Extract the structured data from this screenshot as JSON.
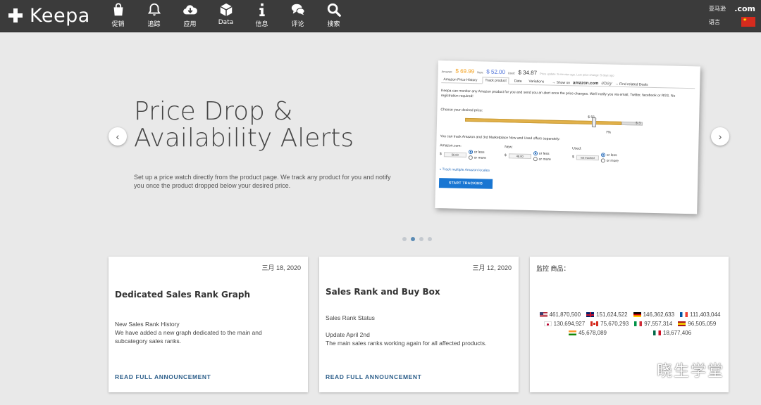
{
  "navbar": {
    "logo_text": "Keepa",
    "items": [
      {
        "label": "促销",
        "icon": "shopping-bag-icon"
      },
      {
        "label": "追踪",
        "icon": "bell-icon"
      },
      {
        "label": "应用",
        "icon": "cloud-download-icon"
      },
      {
        "label": "Data",
        "icon": "cube-icon"
      },
      {
        "label": "信息",
        "icon": "info-icon"
      },
      {
        "label": "评论",
        "icon": "comments-icon"
      },
      {
        "label": "搜索",
        "icon": "search-icon"
      }
    ],
    "right": {
      "marketplace_label": "亚马逊",
      "domain": ".com",
      "language_label": "语言"
    }
  },
  "hero": {
    "title": "Price Drop & Availability Alerts",
    "description": "Set up a price watch directly from the product page. We track any product for you and notify you once the product dropped below your desired price.",
    "screenshot": {
      "amazon_label": "Amazon:",
      "amazon_price": "$ 69.99",
      "new_label": "New:",
      "new_price": "$ 52.00",
      "used_label": "Used:",
      "used_price": "$ 34.87",
      "update_note": "Price update: 5 minutes ago. Last price change: 5 days ago",
      "tabs": [
        "Amazon Price History",
        "Track product",
        "Data",
        "Variations"
      ],
      "show_on": "→ Show on",
      "amazon_logo": "amazon.com",
      "ebay_logo": "ebay",
      "find_deals": "→ Find related Deals",
      "intro": "Keepa can monitor any Amazon product for you and send you an alert once the price changes. We'll notify you via email, Twitter, facebook or RSS. No registration required!",
      "choose_label": "Choose your desired price:",
      "slider_price": "$ 56",
      "slider_pct": "7%",
      "slider_min": "$ 3",
      "track_desc": "You can track Amazon and 3rd Marketplace New and Used offers separately:",
      "columns": [
        {
          "label": "Amazon.com:",
          "value": "56.00",
          "opt1": "or less",
          "opt2": "or more"
        },
        {
          "label": "New:",
          "value": "48.00",
          "opt1": "or less",
          "opt2": "or more"
        },
        {
          "label": "Used:",
          "value": "not tracked",
          "opt1": "or less",
          "opt2": "or more"
        }
      ],
      "multi_link": "» Track multiple Amazon locales",
      "button": "START TRACKING"
    }
  },
  "carousel": {
    "slide_count": 4,
    "active_index": 1
  },
  "cards": [
    {
      "date": "三月 18, 2020",
      "title": "Dedicated Sales Rank Graph",
      "body_1": "New Sales Rank History",
      "body_2": "We have added a new graph dedicated to the main and subcategory sales ranks.",
      "link": "READ FULL ANNOUNCEMENT"
    },
    {
      "date": "三月 12, 2020",
      "title": "Sales Rank and Buy Box",
      "body_1": "Sales Rank Status",
      "body_2": "Update April 2nd",
      "body_3": "The main sales ranks working again for all affected products.",
      "link": "READ FULL ANNOUNCEMENT"
    }
  ],
  "stats": {
    "title": "监控 商品：",
    "items": [
      {
        "flag": "us",
        "value": "461,870,500"
      },
      {
        "flag": "gb",
        "value": "151,624,522"
      },
      {
        "flag": "de",
        "value": "146,362,633"
      },
      {
        "flag": "fr",
        "value": "111,403,044"
      },
      {
        "flag": "jp",
        "value": "130,694,927"
      },
      {
        "flag": "ca",
        "value": "75,670,293"
      },
      {
        "flag": "it",
        "value": "97,557,314"
      },
      {
        "flag": "es",
        "value": "96,505,059"
      },
      {
        "flag": "in",
        "value": "45,678,089"
      },
      {
        "flag": "mx",
        "value": "18,677,406"
      }
    ]
  },
  "watermark": {
    "text": "晓生学堂"
  },
  "colors": {
    "navbar_bg": "#3b3b3b",
    "page_bg": "#e9e9e9",
    "link_blue": "#2c5e8a",
    "amazon_orange": "#f39c12",
    "dot_active": "#5b8bb4"
  }
}
